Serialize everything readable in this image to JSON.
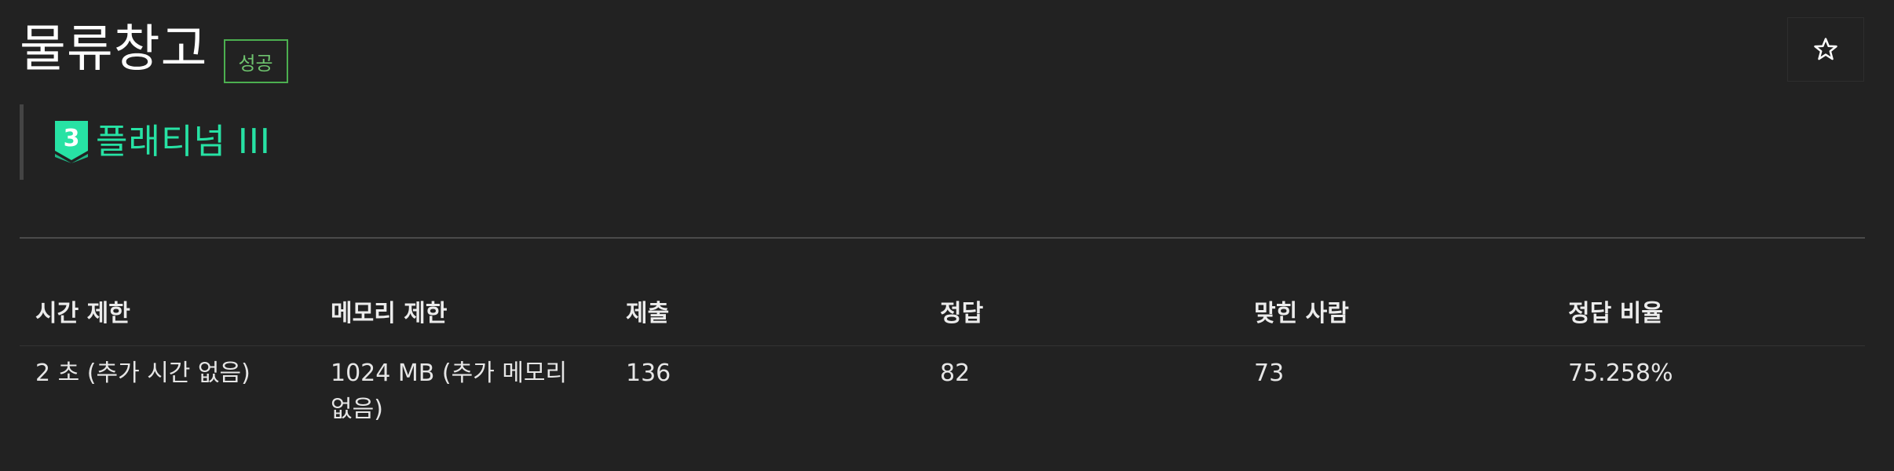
{
  "problem": {
    "title": "물류창고",
    "status_badge": "성공",
    "favorite_icon": "star-icon",
    "tier": {
      "label": "플래티넘 III",
      "icon_number": "3",
      "icon_name": "tier-badge-icon",
      "color": "#27e2a4"
    }
  },
  "colors": {
    "background": "#222222",
    "success": "#4caf50",
    "tier": "#27e2a4"
  },
  "info_table": {
    "headers": [
      "시간 제한",
      "메모리 제한",
      "제출",
      "정답",
      "맞힌 사람",
      "정답 비율"
    ],
    "values": [
      "2 초 (추가 시간 없음)",
      "1024 MB (추가 메모리 없음)",
      "136",
      "82",
      "73",
      "75.258%"
    ]
  }
}
